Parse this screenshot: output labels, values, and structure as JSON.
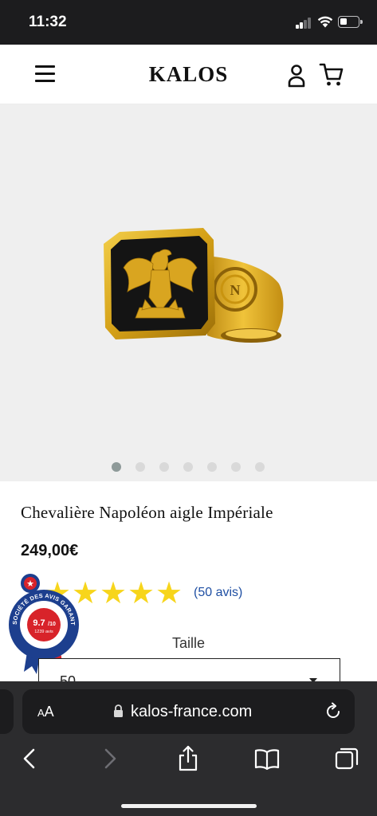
{
  "status_bar": {
    "time": "11:32"
  },
  "header": {
    "logo": "KALOS",
    "menu_icon": "hamburger-menu-icon",
    "account_icon": "account-icon",
    "cart_icon": "cart-icon"
  },
  "gallery": {
    "slide_count": 7,
    "active_slide": 1
  },
  "product": {
    "title": "Chevalière Napoléon aigle Impériale",
    "price": "249,00€",
    "rating": {
      "stars": 5,
      "reviews_label": "(50 avis)"
    }
  },
  "badge": {
    "brand_text": "SOCIÉTÉ DES AVIS GARANTIS",
    "score": "9.7",
    "score_scale": "/10",
    "review_count_label": "1239 avis"
  },
  "size": {
    "label": "Taille",
    "selected": "50"
  },
  "browser": {
    "text_size_label_small": "A",
    "text_size_label_large": "A",
    "url": "kalos-france.com"
  },
  "colors": {
    "star": "#f7d51b",
    "link": "#1f4fa3",
    "gold": "#d4a017",
    "status_bar_bg": "#1c1c1e",
    "browser_bg": "#2c2c2e"
  }
}
